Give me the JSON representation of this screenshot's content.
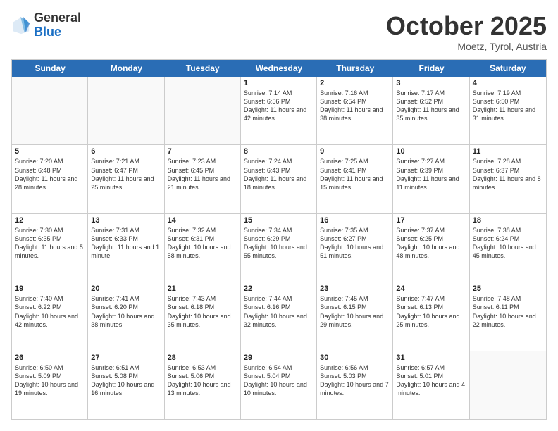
{
  "header": {
    "logo_general": "General",
    "logo_blue": "Blue",
    "month_title": "October 2025",
    "location": "Moetz, Tyrol, Austria"
  },
  "weekdays": [
    "Sunday",
    "Monday",
    "Tuesday",
    "Wednesday",
    "Thursday",
    "Friday",
    "Saturday"
  ],
  "rows": [
    [
      {
        "day": "",
        "text": ""
      },
      {
        "day": "",
        "text": ""
      },
      {
        "day": "",
        "text": ""
      },
      {
        "day": "1",
        "text": "Sunrise: 7:14 AM\nSunset: 6:56 PM\nDaylight: 11 hours and 42 minutes."
      },
      {
        "day": "2",
        "text": "Sunrise: 7:16 AM\nSunset: 6:54 PM\nDaylight: 11 hours and 38 minutes."
      },
      {
        "day": "3",
        "text": "Sunrise: 7:17 AM\nSunset: 6:52 PM\nDaylight: 11 hours and 35 minutes."
      },
      {
        "day": "4",
        "text": "Sunrise: 7:19 AM\nSunset: 6:50 PM\nDaylight: 11 hours and 31 minutes."
      }
    ],
    [
      {
        "day": "5",
        "text": "Sunrise: 7:20 AM\nSunset: 6:48 PM\nDaylight: 11 hours and 28 minutes."
      },
      {
        "day": "6",
        "text": "Sunrise: 7:21 AM\nSunset: 6:47 PM\nDaylight: 11 hours and 25 minutes."
      },
      {
        "day": "7",
        "text": "Sunrise: 7:23 AM\nSunset: 6:45 PM\nDaylight: 11 hours and 21 minutes."
      },
      {
        "day": "8",
        "text": "Sunrise: 7:24 AM\nSunset: 6:43 PM\nDaylight: 11 hours and 18 minutes."
      },
      {
        "day": "9",
        "text": "Sunrise: 7:25 AM\nSunset: 6:41 PM\nDaylight: 11 hours and 15 minutes."
      },
      {
        "day": "10",
        "text": "Sunrise: 7:27 AM\nSunset: 6:39 PM\nDaylight: 11 hours and 11 minutes."
      },
      {
        "day": "11",
        "text": "Sunrise: 7:28 AM\nSunset: 6:37 PM\nDaylight: 11 hours and 8 minutes."
      }
    ],
    [
      {
        "day": "12",
        "text": "Sunrise: 7:30 AM\nSunset: 6:35 PM\nDaylight: 11 hours and 5 minutes."
      },
      {
        "day": "13",
        "text": "Sunrise: 7:31 AM\nSunset: 6:33 PM\nDaylight: 11 hours and 1 minute."
      },
      {
        "day": "14",
        "text": "Sunrise: 7:32 AM\nSunset: 6:31 PM\nDaylight: 10 hours and 58 minutes."
      },
      {
        "day": "15",
        "text": "Sunrise: 7:34 AM\nSunset: 6:29 PM\nDaylight: 10 hours and 55 minutes."
      },
      {
        "day": "16",
        "text": "Sunrise: 7:35 AM\nSunset: 6:27 PM\nDaylight: 10 hours and 51 minutes."
      },
      {
        "day": "17",
        "text": "Sunrise: 7:37 AM\nSunset: 6:25 PM\nDaylight: 10 hours and 48 minutes."
      },
      {
        "day": "18",
        "text": "Sunrise: 7:38 AM\nSunset: 6:24 PM\nDaylight: 10 hours and 45 minutes."
      }
    ],
    [
      {
        "day": "19",
        "text": "Sunrise: 7:40 AM\nSunset: 6:22 PM\nDaylight: 10 hours and 42 minutes."
      },
      {
        "day": "20",
        "text": "Sunrise: 7:41 AM\nSunset: 6:20 PM\nDaylight: 10 hours and 38 minutes."
      },
      {
        "day": "21",
        "text": "Sunrise: 7:43 AM\nSunset: 6:18 PM\nDaylight: 10 hours and 35 minutes."
      },
      {
        "day": "22",
        "text": "Sunrise: 7:44 AM\nSunset: 6:16 PM\nDaylight: 10 hours and 32 minutes."
      },
      {
        "day": "23",
        "text": "Sunrise: 7:45 AM\nSunset: 6:15 PM\nDaylight: 10 hours and 29 minutes."
      },
      {
        "day": "24",
        "text": "Sunrise: 7:47 AM\nSunset: 6:13 PM\nDaylight: 10 hours and 25 minutes."
      },
      {
        "day": "25",
        "text": "Sunrise: 7:48 AM\nSunset: 6:11 PM\nDaylight: 10 hours and 22 minutes."
      }
    ],
    [
      {
        "day": "26",
        "text": "Sunrise: 6:50 AM\nSunset: 5:09 PM\nDaylight: 10 hours and 19 minutes."
      },
      {
        "day": "27",
        "text": "Sunrise: 6:51 AM\nSunset: 5:08 PM\nDaylight: 10 hours and 16 minutes."
      },
      {
        "day": "28",
        "text": "Sunrise: 6:53 AM\nSunset: 5:06 PM\nDaylight: 10 hours and 13 minutes."
      },
      {
        "day": "29",
        "text": "Sunrise: 6:54 AM\nSunset: 5:04 PM\nDaylight: 10 hours and 10 minutes."
      },
      {
        "day": "30",
        "text": "Sunrise: 6:56 AM\nSunset: 5:03 PM\nDaylight: 10 hours and 7 minutes."
      },
      {
        "day": "31",
        "text": "Sunrise: 6:57 AM\nSunset: 5:01 PM\nDaylight: 10 hours and 4 minutes."
      },
      {
        "day": "",
        "text": ""
      }
    ]
  ]
}
